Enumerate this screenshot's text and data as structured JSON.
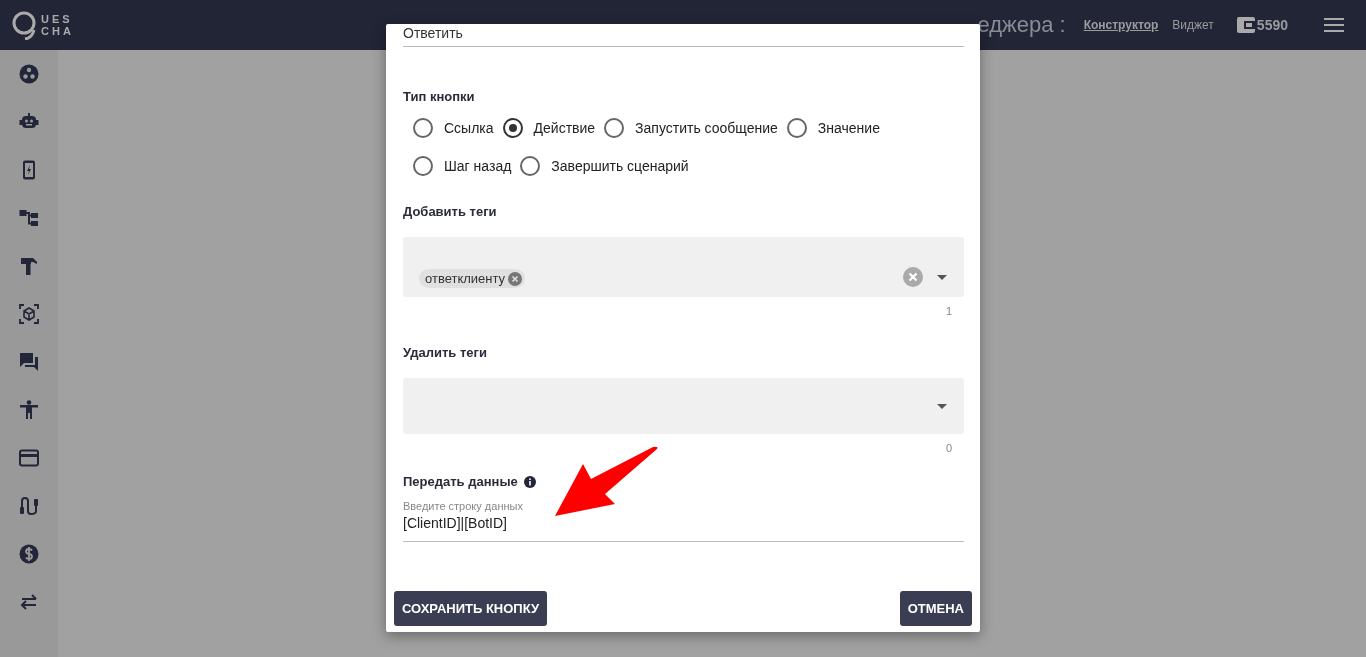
{
  "header": {
    "logo": [
      "UES",
      "CHA"
    ],
    "title": "еджера :",
    "nav": [
      {
        "label": "Конструктор",
        "selected": true
      },
      {
        "label": "Виджет",
        "selected": false
      }
    ],
    "balance": "5590"
  },
  "dialog": {
    "reply_field": {
      "value": "Ответить"
    },
    "button_type": {
      "label": "Тип кнопки",
      "options": [
        {
          "label": "Ссылка",
          "selected": false
        },
        {
          "label": "Действие",
          "selected": true
        },
        {
          "label": "Запустить сообщение",
          "selected": false
        },
        {
          "label": "Значение",
          "selected": false
        },
        {
          "label": "Шаг назад",
          "selected": false
        },
        {
          "label": "Завершить сценарий",
          "selected": false
        }
      ]
    },
    "add_tags": {
      "label": "Добавить теги",
      "tags": [
        "ответклиенту"
      ],
      "count": "1"
    },
    "remove_tags": {
      "label": "Удалить теги",
      "count": "0"
    },
    "pass_data": {
      "label": "Передать данные",
      "field_label": "Введите строку данных",
      "value": "[ClientID]|[BotID]"
    },
    "buttons": [
      {
        "label": "СОХРАНИТЬ КНОПКУ"
      },
      {
        "label": "ОТМЕНА"
      }
    ]
  }
}
